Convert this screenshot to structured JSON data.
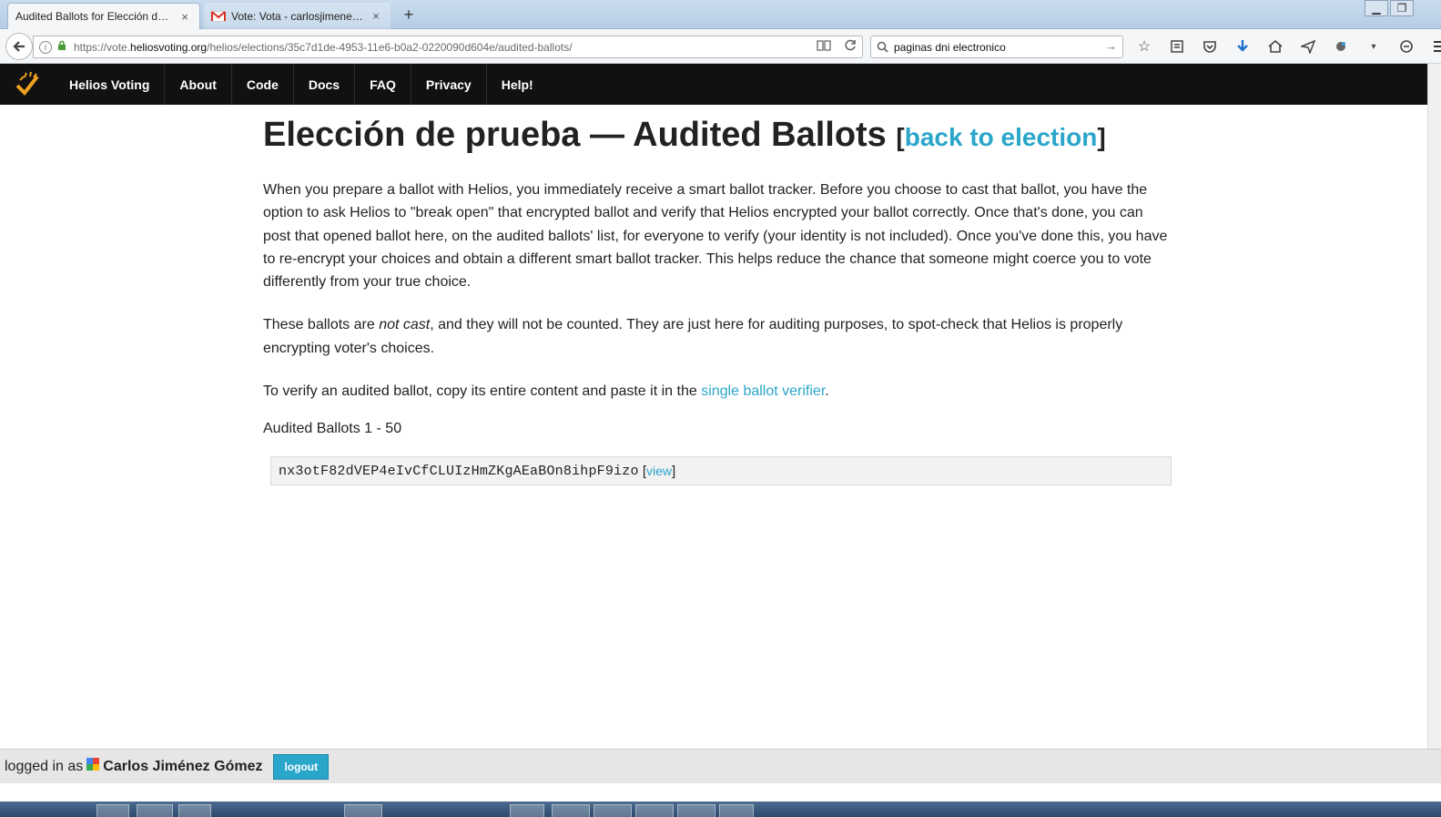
{
  "browser": {
    "tabs": [
      {
        "label": "Audited Ballots for Elección de ...",
        "close": "×"
      },
      {
        "label": "Vote: Vota - carlosjimenez...",
        "close": "×"
      }
    ],
    "new_tab": "+",
    "url": {
      "scheme": "https://vote.",
      "host": "heliosvoting.org",
      "path": "/helios/elections/35c7d1de-4953-11e6-b0a2-0220090d604e/audited-ballots/"
    },
    "search_value": "paginas dni electronico"
  },
  "helios_nav": {
    "items": [
      "Helios Voting",
      "About",
      "Code",
      "Docs",
      "FAQ",
      "Privacy",
      "Help!"
    ]
  },
  "main": {
    "title": "Elección de prueba — Audited Ballots",
    "back_link": "back to election",
    "p1": "When you prepare a ballot with Helios, you immediately receive a smart ballot tracker. Before you choose to cast that ballot, you have the option to ask Helios to \"break open\" that encrypted ballot and verify that Helios encrypted your ballot correctly. Once that's done, you can post that opened ballot here, on the audited ballots' list, for everyone to verify (your identity is not included). Once you've done this, you have to re-encrypt your choices and obtain a different smart ballot tracker. This helps reduce the chance that someone might coerce you to vote differently from your true choice.",
    "p2_before": "These ballots are ",
    "p2_em": "not cast",
    "p2_after": ", and they will not be counted. They are just here for auditing purposes, to spot-check that Helios is properly encrypting voter's choices.",
    "p3_before": "To verify an audited ballot, copy its entire content and paste it in the ",
    "p3_link": "single ballot verifier",
    "p3_after": ".",
    "audited_heading": "Audited Ballots 1 - 50",
    "ballots": [
      {
        "hash": "nx3otF82dVEP4eIvCfCLUIzHmZKgAEaBOn8ihpF9izo",
        "view_label": "view"
      }
    ]
  },
  "footer": {
    "logged_in_as": "logged in as",
    "user": "Carlos Jiménez Gómez",
    "logout": "logout"
  },
  "colors": {
    "link": "#2ba6cb",
    "nav_bg": "#111111",
    "logo_orange": "#f0a020"
  }
}
